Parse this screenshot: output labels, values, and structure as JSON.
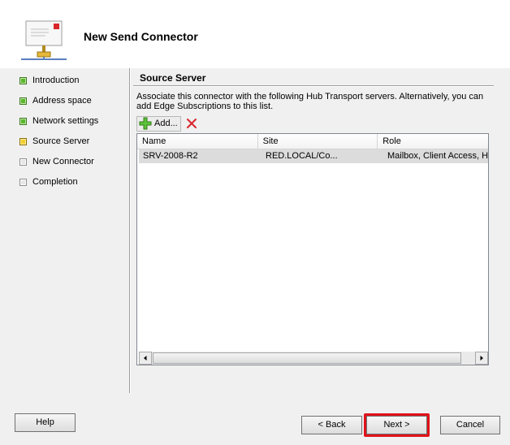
{
  "header": {
    "title": "New Send Connector"
  },
  "nav": {
    "items": [
      {
        "label": "Introduction",
        "state": "done"
      },
      {
        "label": "Address space",
        "state": "done"
      },
      {
        "label": "Network settings",
        "state": "done"
      },
      {
        "label": "Source Server",
        "state": "current"
      },
      {
        "label": "New Connector",
        "state": "pending"
      },
      {
        "label": "Completion",
        "state": "pending"
      }
    ]
  },
  "content": {
    "section_title": "Source Server",
    "description": "Associate this connector with the following Hub Transport servers. Alternatively, you can add Edge Subscriptions to this list.",
    "toolbar": {
      "add_label": "Add...",
      "add_icon": "green-plus-icon",
      "remove_icon": "red-x-icon"
    },
    "table": {
      "columns": [
        "Name",
        "Site",
        "Role"
      ],
      "rows": [
        {
          "name": "SRV-2008-R2",
          "site": "RED.LOCAL/Co...",
          "role": "Mailbox, Client Access, Hu"
        }
      ]
    }
  },
  "buttons": {
    "help": "Help",
    "back": "< Back",
    "next": "Next >",
    "cancel": "Cancel"
  },
  "colors": {
    "step_done": "#58b82a",
    "step_current": "#f1cf2a",
    "highlight": "#e0121a"
  }
}
